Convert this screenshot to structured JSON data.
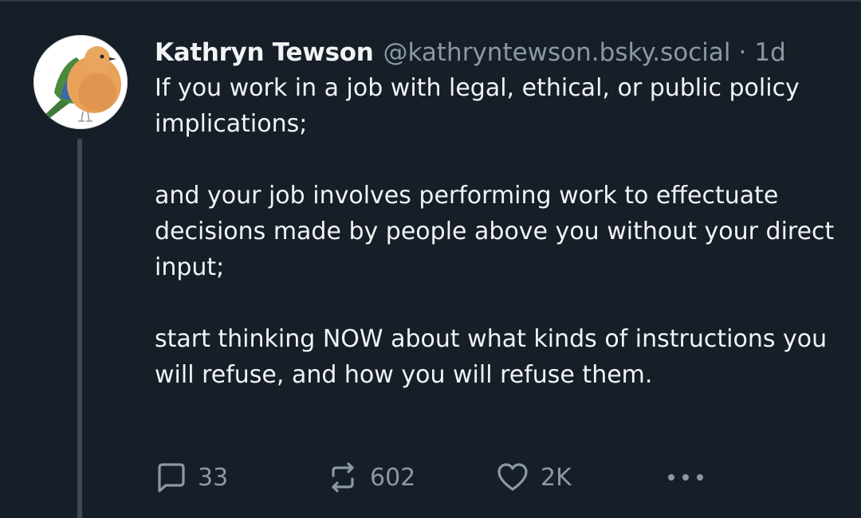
{
  "post": {
    "author_name": "Kathryn Tewson",
    "handle": "@kathryntewson.bsky.social",
    "separator": "·",
    "timestamp": "1d",
    "avatar_icon": "bird-illustration-avatar",
    "paragraphs": [
      "If you work in a job with legal, ethical, or public policy implications;",
      "and your job involves performing work to effectuate decisions made by people above you without your direct input;",
      "start thinking NOW about what kinds of instructions you will refuse, and how you will refuse them."
    ],
    "actions": {
      "reply_count": "33",
      "repost_count": "602",
      "like_count": "2K",
      "reply_icon": "speech-bubble-icon",
      "repost_icon": "repost-arrows-icon",
      "like_icon": "heart-icon",
      "more_icon": "ellipsis-icon"
    }
  },
  "colors": {
    "background": "#161e27",
    "text_primary": "#f1f3f5",
    "text_secondary": "#8b98a7",
    "thread_line": "#3a4a5d"
  }
}
